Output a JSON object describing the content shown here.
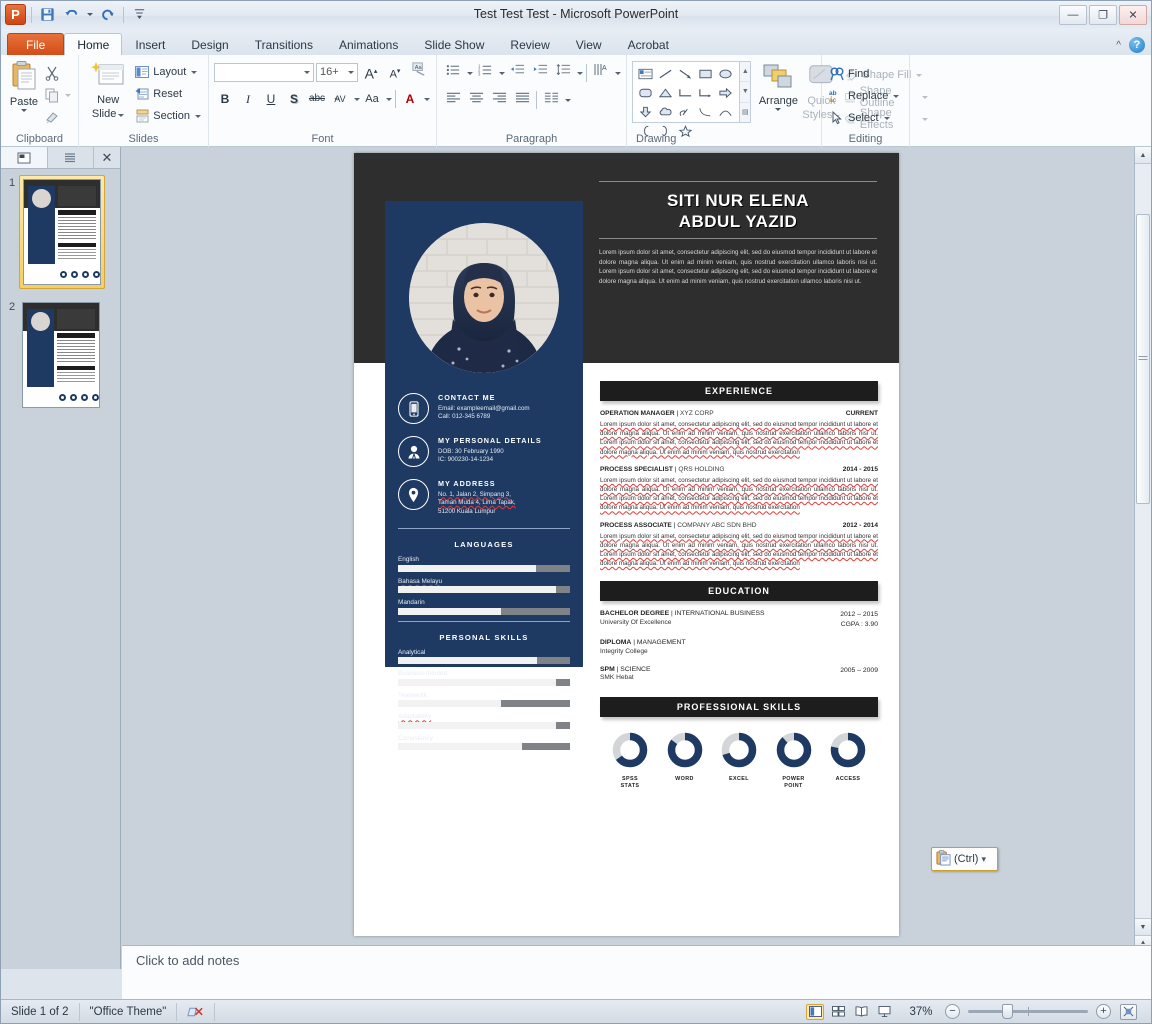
{
  "window": {
    "title": "Test Test Test  -  Microsoft PowerPoint",
    "logo_letter": "P",
    "minimize": "—",
    "restore": "❐",
    "close": "✕",
    "help_label": "?",
    "collapse_ribbon": "^"
  },
  "quick_access": [
    {
      "name": "save-icon",
      "label": "Save"
    },
    {
      "name": "undo-icon",
      "label": "Undo"
    },
    {
      "name": "redo-icon",
      "label": "Redo"
    },
    {
      "name": "customize-qat-icon",
      "label": "Customize Quick Access Toolbar"
    }
  ],
  "tabs": [
    {
      "label": "File",
      "type": "file"
    },
    {
      "label": "Home",
      "type": "active"
    },
    {
      "label": "Insert",
      "type": "normal"
    },
    {
      "label": "Design",
      "type": "normal"
    },
    {
      "label": "Transitions",
      "type": "normal"
    },
    {
      "label": "Animations",
      "type": "normal"
    },
    {
      "label": "Slide Show",
      "type": "normal"
    },
    {
      "label": "Review",
      "type": "normal"
    },
    {
      "label": "View",
      "type": "normal"
    },
    {
      "label": "Acrobat",
      "type": "normal"
    }
  ],
  "ribbon": {
    "clipboard": {
      "group_label": "Clipboard",
      "paste": "Paste",
      "cut": "Cut",
      "copy": "Copy",
      "format_painter": "Format Painter"
    },
    "slides": {
      "group_label": "Slides",
      "new_slide_line1": "New",
      "new_slide_line2": "Slide",
      "layout": "Layout",
      "reset": "Reset",
      "section": "Section"
    },
    "font": {
      "group_label": "Font",
      "font_name": "",
      "font_size": "16+",
      "bold": "B",
      "italic": "I",
      "underline": "U",
      "shadow": "S",
      "strikethrough": "abc",
      "character_spacing": "AV",
      "change_case": "Aa",
      "font_color": "A",
      "clear_formatting": "Clear All Formatting",
      "grow_font": "A",
      "shrink_font": "A"
    },
    "paragraph": {
      "group_label": "Paragraph",
      "bullets": "Bullets",
      "numbering": "Numbering",
      "decrease_indent": "Decrease List Level",
      "increase_indent": "Increase List Level",
      "line_spacing": "Line Spacing",
      "text_direction": "Text Direction",
      "align_text": "Align Text",
      "convert_smartart": "Convert to SmartArt",
      "align_left": "Align Text Left",
      "center": "Center",
      "align_right": "Align Text Right",
      "justify": "Justify",
      "columns": "Columns"
    },
    "drawing": {
      "group_label": "Drawing",
      "arrange": "Arrange",
      "quick_styles_line1": "Quick",
      "quick_styles_line2": "Styles",
      "shape_fill": "Shape Fill",
      "shape_outline": "Shape Outline",
      "shape_effects": "Shape Effects"
    },
    "editing": {
      "group_label": "Editing",
      "find": "Find",
      "replace": "Replace",
      "select": "Select"
    }
  },
  "slides_pane": {
    "tab_slides": "Slides",
    "tab_outline": "Outline",
    "close": "✕",
    "thumbnails": [
      {
        "number": "1",
        "selected": true
      },
      {
        "number": "2",
        "selected": false
      }
    ]
  },
  "paste_options": {
    "label": "(Ctrl)",
    "icon": "clipboard-icon",
    "caret": "▾"
  },
  "notes": {
    "placeholder": "Click to add notes"
  },
  "status_bar": {
    "slide_counter": "Slide 1 of 2",
    "theme": "\"Office Theme\"",
    "spellcheck_icon": "spellcheck-icon",
    "zoom_level": "37%",
    "zoom_out": "−",
    "zoom_in": "+",
    "fit_slide": "Fit slide to current window",
    "views": [
      {
        "name": "normal-view",
        "selected": true
      },
      {
        "name": "slide-sorter-view",
        "selected": false
      },
      {
        "name": "reading-view",
        "selected": false
      },
      {
        "name": "slide-show-view",
        "selected": false
      }
    ]
  },
  "resume": {
    "name_line1": "SITI NUR ELENA",
    "name_line2": "ABDUL YAZID",
    "profile_text": "Lorem ipsum dolor sit amet, consectetur adipiscing elit, sed do eiusmod tempor incididunt ut labore et dolore magna aliqua. Ut enim ad minim veniam, quis nostrud exercitation ullamco laboris nisi ut. Lorem ipsum dolor sit amet, consectetur adipiscing elit, sed do eiusmod tempor incididunt ut labore et dolore magna aliqua. Ut enim ad minim veniam, quis nostrud exercitation ullamco laboris nisi ut.",
    "contact": [
      {
        "icon": "phone-icon",
        "title": "CONTACT  ME",
        "lines": [
          "Email: exampleemail@gmail.com",
          "Call: 012-345 6789"
        ]
      },
      {
        "icon": "person-icon",
        "title": "MY PERSONAL DETAILS",
        "lines": [
          "DOB: 30 February 1990",
          "IC: 900230-14-1234"
        ]
      },
      {
        "icon": "location-pin-icon",
        "title": "MY ADDRESS",
        "lines": [
          "No. 1, Jalan 2, Simpang 3,",
          "Taman Muda 4, Lima Tapak,",
          "51200 Kuala Lumpur"
        ]
      }
    ],
    "languages_heading": "LANGUAGES",
    "languages": [
      {
        "label": "English",
        "value": 80
      },
      {
        "label": "Bahasa Melayu",
        "value": 92
      },
      {
        "label": "Mandarin",
        "value": 60
      }
    ],
    "personal_skills_heading": "PERSONAL  SKILLS",
    "personal_skills": [
      {
        "label": "Analytical",
        "value": 81
      },
      {
        "label": "Business-minded",
        "value": 92
      },
      {
        "label": "Teamwork",
        "value": 60
      },
      {
        "label": "Adaptability",
        "value": 92
      },
      {
        "label": "Consistency",
        "value": 72
      }
    ],
    "experience_heading": "EXPERIENCE",
    "experience": [
      {
        "role": "OPERATION MANAGER",
        "company": "XYZ CORP",
        "date": "CURRENT",
        "body": "Lorem ipsum dolor sit amet, consectetur adipiscing elit, sed do eiusmod tempor incididunt ut labore et dolore magna aliqua. Ut enim ad minim veniam, quis nostrud exercitation ullamco laboris nisi ut. Lorem ipsum dolor sit amet, consectetur adipiscing elit, sed do eiusmod tempor incididunt ut labore et dolore magna aliqua. Ut enim ad minim veniam, quis nostrud exercitation"
      },
      {
        "role": "PROCESS SPECIALIST",
        "company": "QRS HOLDING",
        "date": "2014 - 2015",
        "body": "Lorem ipsum dolor sit amet, consectetur adipiscing elit, sed do eiusmod tempor incididunt ut labore et dolore magna aliqua. Ut enim ad minim veniam, quis nostrud exercitation ullamco laboris nisi ut. Lorem ipsum dolor sit amet, consectetur adipiscing elit, sed do eiusmod tempor incididunt ut labore et dolore magna aliqua. Ut enim ad minim veniam, quis nostrud exercitation"
      },
      {
        "role": "PROCESS ASSOCIATE",
        "company": "COMPANY ABC SDN BHD",
        "date": "2012 - 2014",
        "body": "Lorem ipsum dolor sit amet, consectetur adipiscing elit, sed do eiusmod tempor incididunt ut labore et dolore magna aliqua. Ut enim ad minim veniam, quis nostrud exercitation ullamco laboris nisi ut. Lorem ipsum dolor sit amet, consectetur adipiscing elit, sed do eiusmod tempor incididunt ut labore et dolore magna aliqua. Ut enim ad minim veniam, quis nostrud exercitation"
      }
    ],
    "education_heading": "EDUCATION",
    "education": [
      {
        "degree": "BACHELOR DEGREE",
        "field": "INTERNATIONAL BUSINESS",
        "school": "University Of Excellence",
        "date": "2012 – 2015",
        "extra": "CGPA : 3.90"
      },
      {
        "degree": "DIPLOMA",
        "field": "MANAGEMENT",
        "school": "Integrity College",
        "date": "",
        "extra": ""
      },
      {
        "degree": "SPM",
        "field": "SCIENCE",
        "school": "SMK Hebat",
        "date": "2005 – 2009",
        "extra": ""
      }
    ],
    "professional_skills_heading": "PROFESSIONAL SKILLS",
    "professional_skills": [
      {
        "label_line1": "SPSS",
        "label_line2": "STATS",
        "value": 65
      },
      {
        "label_line1": "WORD",
        "label_line2": "",
        "value": 85
      },
      {
        "label_line1": "EXCEL",
        "label_line2": "",
        "value": 70
      },
      {
        "label_line1": "POWER",
        "label_line2": "POINT",
        "value": 88
      },
      {
        "label_line1": "ACCESS",
        "label_line2": "",
        "value": 78
      }
    ],
    "colors": {
      "navy": "#1e3a63",
      "dark": "#2e2e2e",
      "bar_track": "#7f8286",
      "bar_fill": "#f2f2f2"
    }
  }
}
